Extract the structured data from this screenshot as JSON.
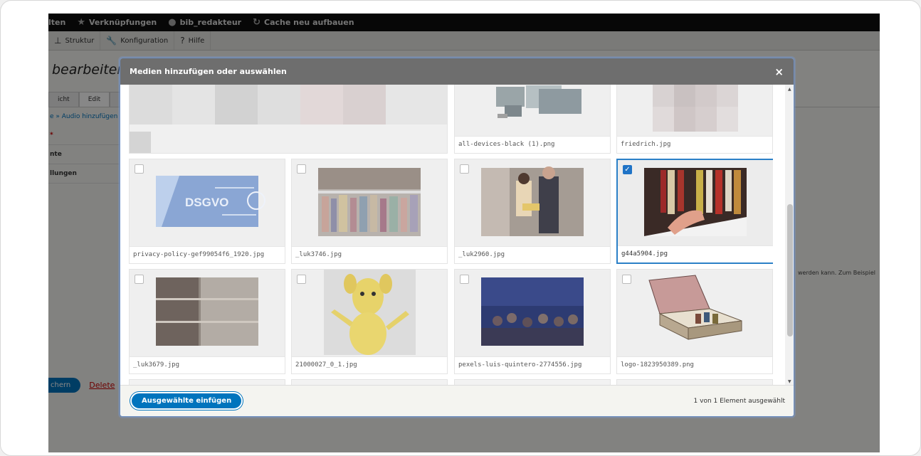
{
  "toolbar": {
    "items": [
      {
        "icon": "partial",
        "label": "lten"
      },
      {
        "icon": "star-icon",
        "label": "Verknüpfungen"
      },
      {
        "icon": "user-icon",
        "label": "bib_redakteur"
      },
      {
        "icon": "refresh-icon",
        "label": "Cache neu aufbauen"
      }
    ],
    "sub_items": [
      {
        "icon": "structure-icon",
        "label": "Struktur"
      },
      {
        "icon": "wrench-icon",
        "label": "Konfiguration"
      },
      {
        "icon": "help-icon",
        "label": "Hilfe"
      }
    ]
  },
  "page": {
    "title": "bearbeiten Ele",
    "tabs": [
      "icht",
      "Edit",
      "I"
    ],
    "breadcrumb": "e » Audio hinzufügen",
    "side_items": [
      "*",
      "nte",
      "llungen"
    ],
    "save_label": "chern",
    "delete_label": "Delete",
    "right_text": "werden kann. Zum Beispiel"
  },
  "dialog": {
    "title": "Medien hinzufügen oder auswählen",
    "close": "×",
    "insert_label": "Ausgewählte einfügen",
    "selection_status": "1 von 1 Element ausgewählt",
    "tiles_row0": [
      "",
      "all-devices-black (1).png",
      "friedrich.jpg"
    ],
    "tiles_row1": [
      "privacy-policy-gef99054f6_1920.jpg",
      "_luk3746.jpg",
      "_luk2960.jpg",
      "g44a5904.jpg"
    ],
    "tiles_row2": [
      "_luk3679.jpg",
      "21000027_0_1.jpg",
      "pexels-luis-quintero-2774556.jpg",
      "logo-1823950389.png"
    ],
    "dsgvo_text": "DSGVO",
    "checked_mark": "✓"
  },
  "colors": {
    "accent": "#0074bd",
    "selected_border": "#2b80c7"
  }
}
